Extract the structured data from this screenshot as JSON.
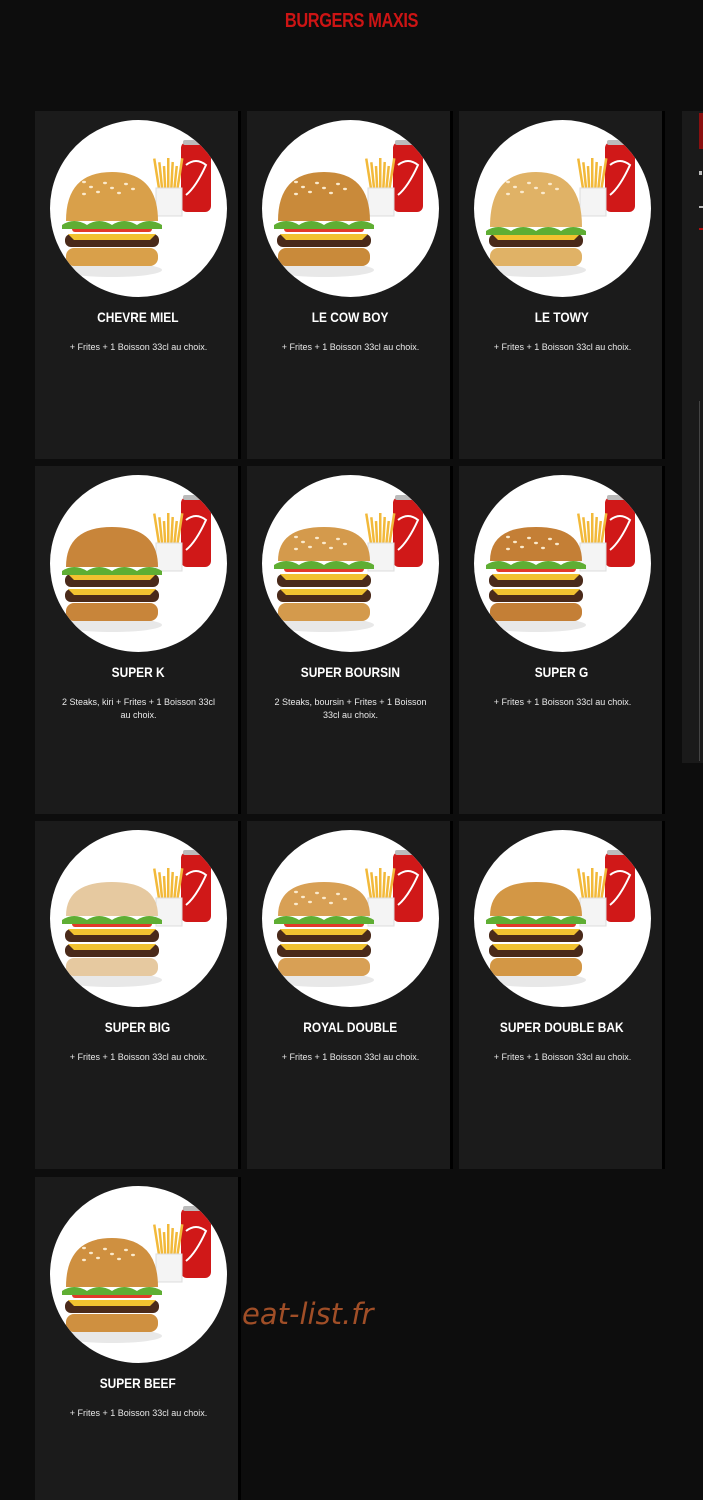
{
  "page": {
    "title": "BURGERS MAXIS",
    "watermark": "eat-list.fr"
  },
  "colors": {
    "accent": "#cc1414",
    "card_bg": "#1b1b1b",
    "page_bg": "#0d0d0d",
    "watermark": "#b0562a"
  },
  "menu": {
    "items": [
      {
        "name": "CHEVRE MIEL",
        "description": "+ Frites + 1 Boisson 33cl au choix.",
        "image_icon": "burger-cheese-honey-icon"
      },
      {
        "name": "LE COW BOY",
        "description": "+ Frites + 1 Boisson 33cl au choix.",
        "image_icon": "burger-cowboy-icon"
      },
      {
        "name": "LE TOWY",
        "description": "+ Frites + 1 Boisson 33cl au choix.",
        "image_icon": "burger-chicken-icon"
      },
      {
        "name": "SUPER K",
        "description": "2 Steaks, kiri + Frites + 1 Boisson 33cl au choix.",
        "image_icon": "burger-double-icon"
      },
      {
        "name": "SUPER BOURSIN",
        "description": "2 Steaks, boursin + Frites + 1 Boisson 33cl au choix.",
        "image_icon": "burger-sesame-icon"
      },
      {
        "name": "SUPER G",
        "description": "+ Frites + 1 Boisson 33cl au choix.",
        "image_icon": "burger-tomato-icon"
      },
      {
        "name": "SUPER BIG",
        "description": "+ Frites + 1 Boisson 33cl au choix.",
        "image_icon": "burger-big-icon"
      },
      {
        "name": "ROYAL DOUBLE",
        "description": "+ Frites + 1 Boisson 33cl au choix.",
        "image_icon": "burger-royal-icon"
      },
      {
        "name": "SUPER DOUBLE BAK",
        "description": "+ Frites + 1 Boisson 33cl au choix.",
        "image_icon": "burger-bacon-icon"
      },
      {
        "name": "SUPER BEEF",
        "description": "+ Frites + 1 Boisson 33cl au choix.",
        "image_icon": "burger-beef-icon"
      }
    ]
  }
}
